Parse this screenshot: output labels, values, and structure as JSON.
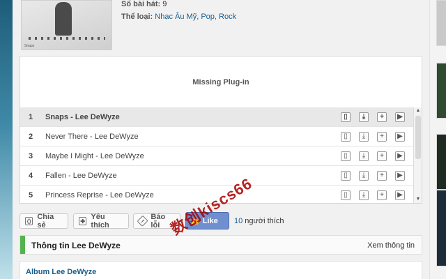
{
  "album": {
    "cover_caption": "Snaps",
    "song_count_label": "Số bài hát:",
    "song_count": "9",
    "genre_label": "Thể loại:",
    "genres": "Nhạc Âu Mỹ, Pop, Rock"
  },
  "player": {
    "plugin_message": "Missing Plug-in",
    "tracks": [
      {
        "num": "1",
        "title": "Snaps - Lee DeWyze"
      },
      {
        "num": "2",
        "title": "Never There - Lee DeWyze"
      },
      {
        "num": "3",
        "title": "Maybe I Might - Lee DeWyze"
      },
      {
        "num": "4",
        "title": "Fallen - Lee DeWyze"
      },
      {
        "num": "5",
        "title": "Princess Reprise - Lee DeWyze"
      }
    ],
    "scroll_up": "▲",
    "scroll_down": "▼"
  },
  "actions": {
    "share": "Chia sẻ",
    "favorite": "Yêu thích",
    "report": "Báo lỗi",
    "like_button": "Like",
    "like_count": "10",
    "like_text": " người thích"
  },
  "section": {
    "title": "Thông tin Lee DeWyze",
    "more": "Xem thông tin"
  },
  "bottom": {
    "album_link": "Album Lee DeWyze"
  },
  "watermark": "数创kiscs66",
  "icons": {
    "phone": "▯",
    "download": "⤓",
    "add": "+",
    "play": "▶",
    "share": "⟨⟩",
    "favorite": "✚",
    "report": "!",
    "thumbs_up": "👍"
  },
  "colors": {
    "link": "#1a5d8c",
    "section_bar": "#52b44f",
    "like_button": "#6f8fcf"
  }
}
